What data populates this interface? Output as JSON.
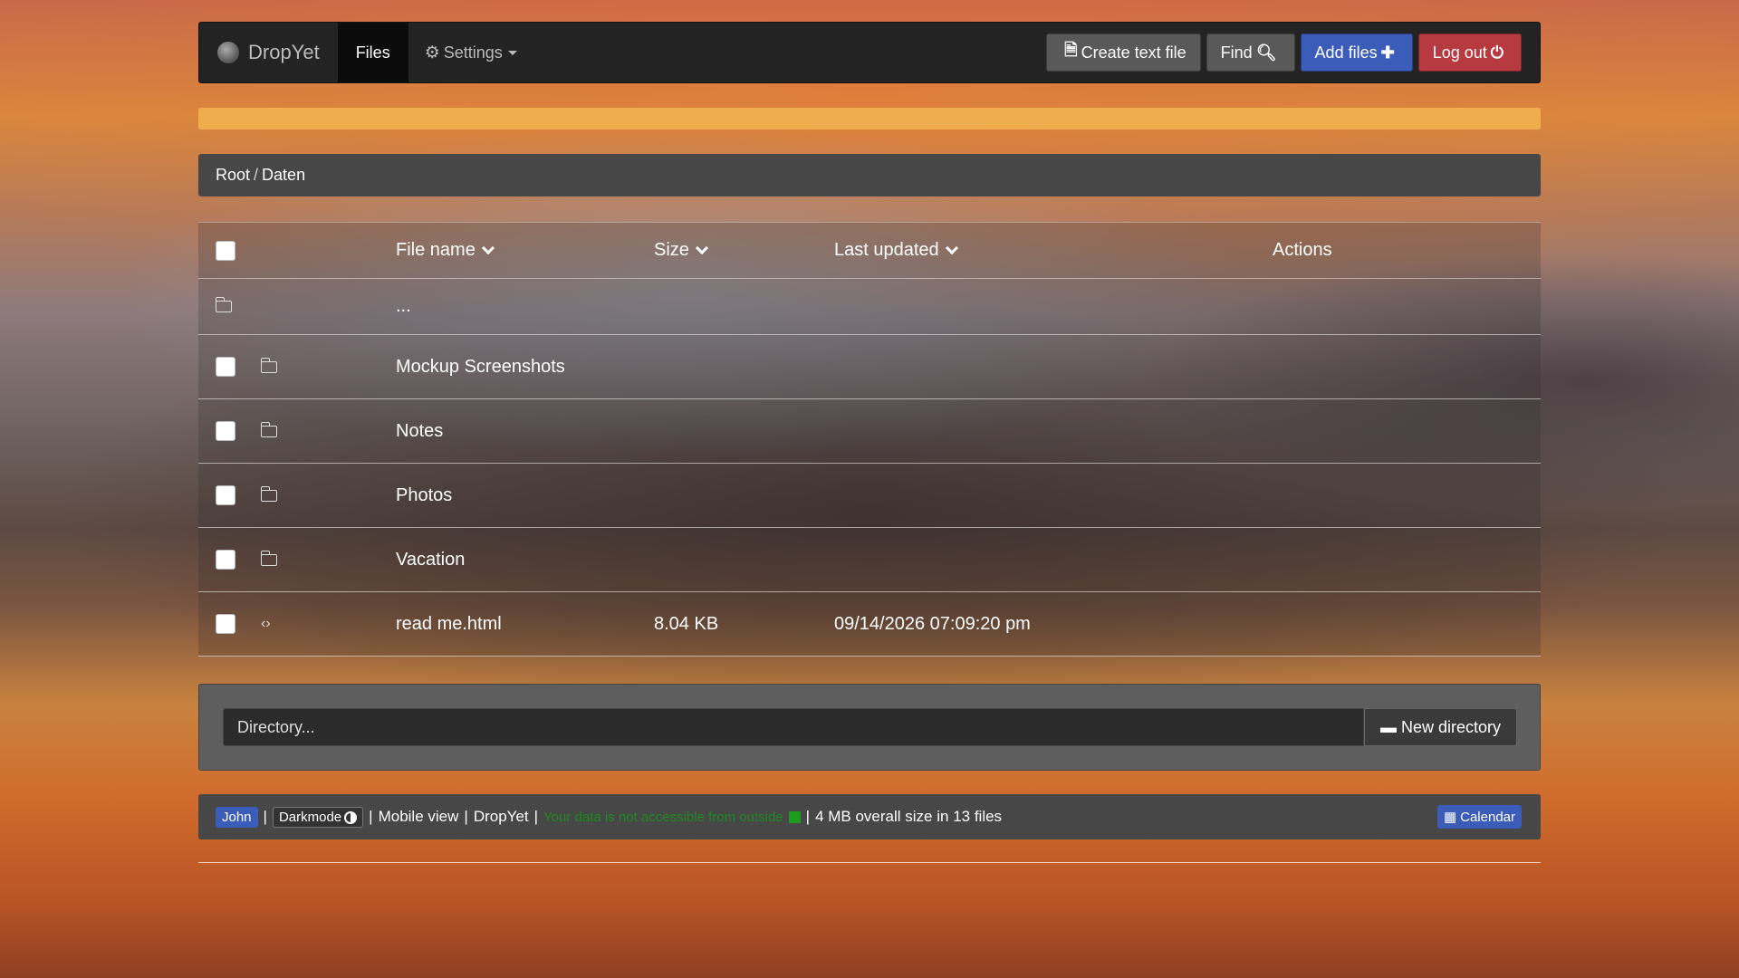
{
  "navbar": {
    "brand": "DropYet",
    "files_label": "Files",
    "settings_label": "Settings",
    "buttons": {
      "create_text_file": "Create text file",
      "find": "Find",
      "add_files": "Add files",
      "log_out": "Log out"
    }
  },
  "progress": {
    "value_fraction": 1.0,
    "color": "#f0ad4e"
  },
  "breadcrumb": {
    "root": "Root",
    "separator": "/",
    "current": "Daten"
  },
  "table": {
    "headers": {
      "name": "File name",
      "size": "Size",
      "updated": "Last updated",
      "actions": "Actions"
    },
    "parent_row": {
      "label": "..."
    },
    "rows": [
      {
        "name": "Mockup Screenshots",
        "type": "folder",
        "size": "",
        "updated": ""
      },
      {
        "name": "Notes",
        "type": "folder",
        "size": "",
        "updated": ""
      },
      {
        "name": "Photos",
        "type": "folder",
        "size": "",
        "updated": ""
      },
      {
        "name": "Vacation",
        "type": "folder",
        "size": "",
        "updated": ""
      },
      {
        "name": "read me.html",
        "type": "code-file",
        "size": "8.04 KB",
        "updated": "09/14/2026 07:09:20 pm"
      }
    ]
  },
  "new_directory": {
    "placeholder": "Directory...",
    "button_label": "New directory"
  },
  "footer": {
    "user": "John",
    "darkmode_label": "Darkmode",
    "mobile_view": "Mobile view",
    "app_name": "DropYet",
    "status_text": "Your data is not accessible from outside",
    "overall": "4 MB overall size in 13 files",
    "calendar_label": "Calendar"
  },
  "colors": {
    "accent_blue": "#3b5cb8",
    "danger_red": "#b63a40",
    "warning_orange": "#f0ad4e",
    "status_green": "#1f9b1f"
  }
}
